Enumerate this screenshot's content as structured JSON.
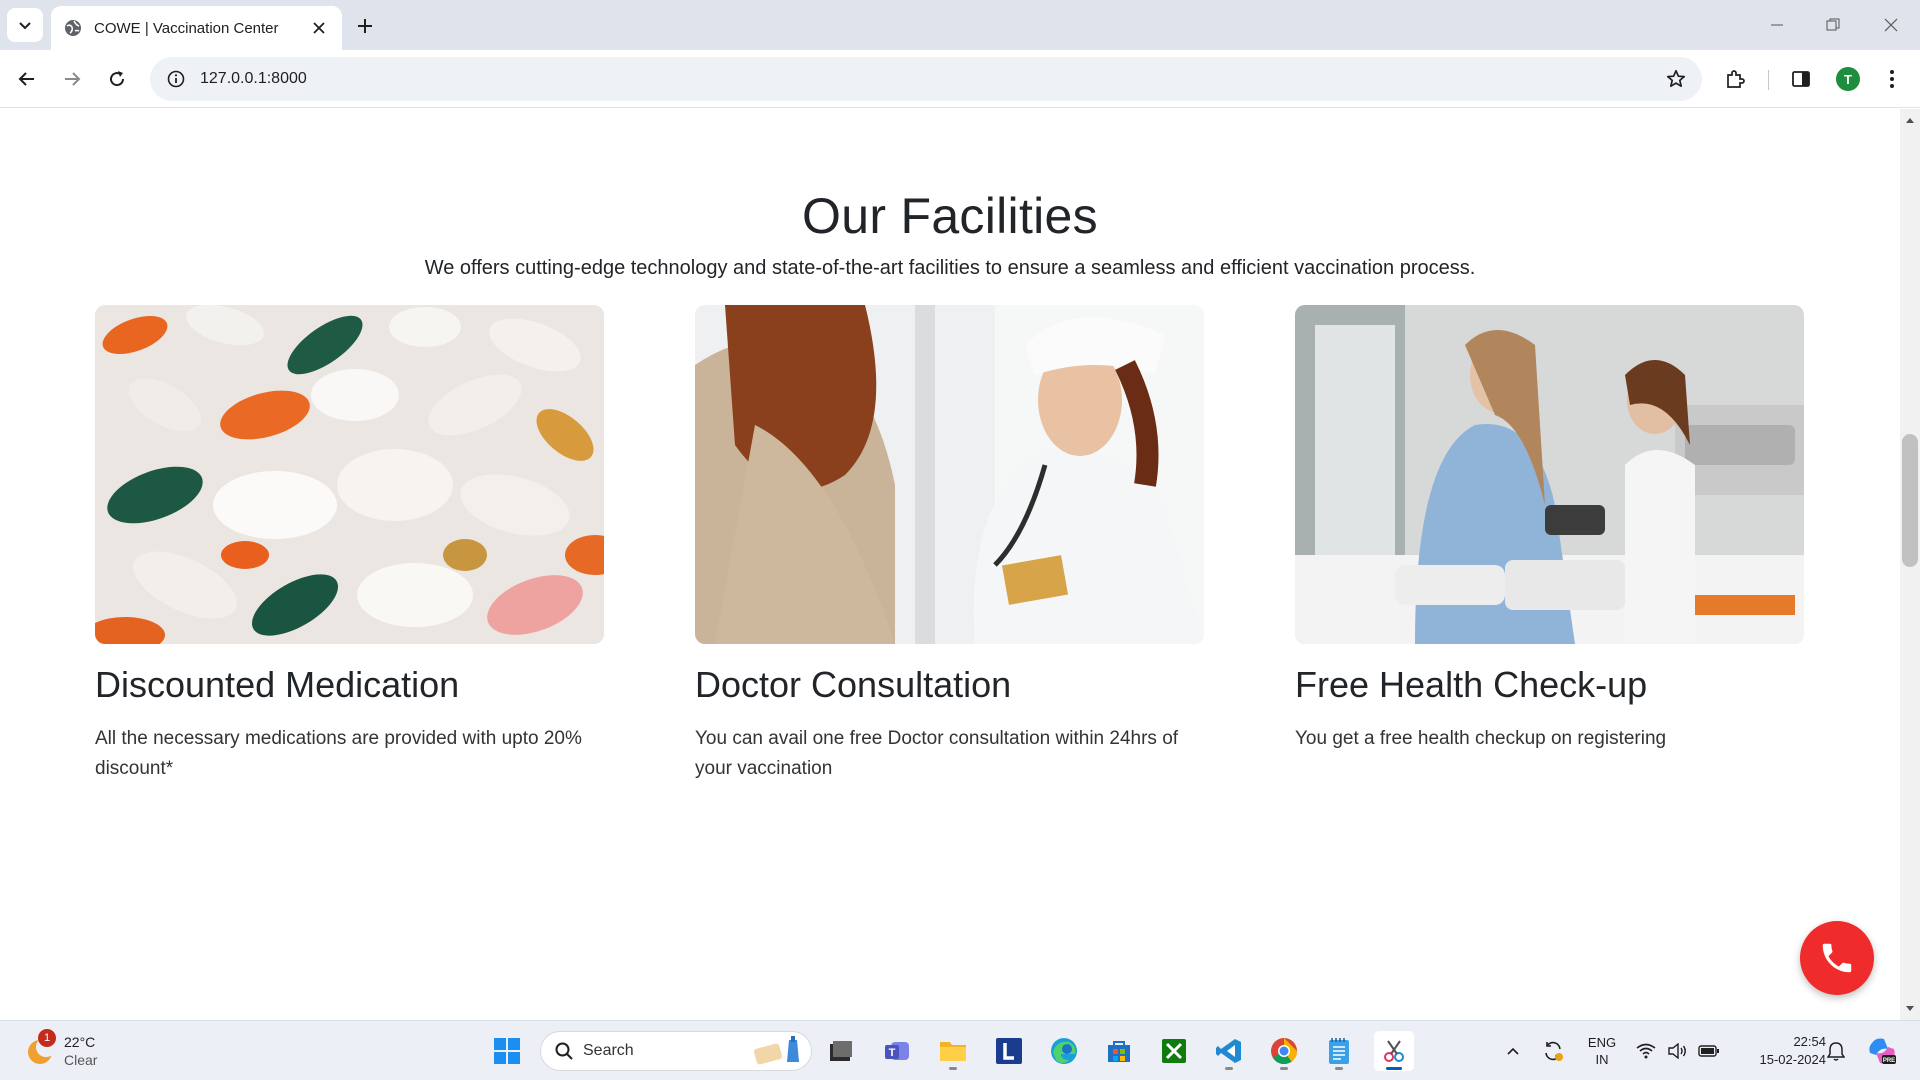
{
  "browser": {
    "tab_title": "COWE | Vaccination Center",
    "url": "127.0.0.1:8000",
    "profile_initial": "T"
  },
  "page": {
    "section_title": "Our Facilities",
    "section_subtitle": "We offers cutting-edge technology and state-of-the-art facilities to ensure a seamless and efficient vaccination process.",
    "facilities": [
      {
        "title": "Discounted Medication",
        "text": "All the necessary medications are provided with upto 20% discount*",
        "image": "pills-photo"
      },
      {
        "title": "Doctor Consultation",
        "text": "You can avail one free Doctor consultation within 24hrs of your vaccination",
        "image": "doctor-stethoscope-photo"
      },
      {
        "title": "Free Health Check-up",
        "text": "You get a free health checkup on registering",
        "image": "child-checkup-photo"
      }
    ],
    "call_button_icon": "phone-icon"
  },
  "taskbar": {
    "weather": {
      "temp": "22°C",
      "condition": "Clear",
      "badge": "1"
    },
    "search_placeholder": "Search",
    "language": {
      "line1": "ENG",
      "line2": "IN"
    },
    "clock": {
      "time": "22:54",
      "date": "15-02-2024"
    }
  },
  "colors": {
    "accent_call": "#ef2b2b",
    "profile_green": "#1e8e3e",
    "text_dark": "#212529"
  }
}
